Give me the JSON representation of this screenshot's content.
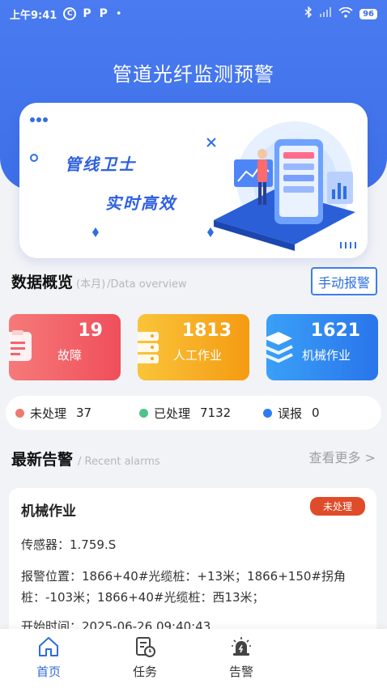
{
  "status_bar": {
    "time": "上午9:41",
    "battery": "96"
  },
  "header": {
    "title": "管道光纤监测预警"
  },
  "banner": {
    "line1": "管线卫士",
    "line2": "实时高效"
  },
  "overview": {
    "title": "数据概览",
    "period": "(本月)",
    "subtitle": "/Data overview",
    "manual_button": "手动报警",
    "cards": [
      {
        "value": "19",
        "label": "故障",
        "color": "#f0505c",
        "icon": "clipboard-icon"
      },
      {
        "value": "1813",
        "label": "人工作业",
        "color": "#f5a51a",
        "icon": "server-stack-icon"
      },
      {
        "value": "1621",
        "label": "机械作业",
        "color": "#2b7bed",
        "icon": "layers-icon"
      }
    ],
    "statuses": [
      {
        "label": "未处理",
        "value": "37",
        "color": "#ef7a6f"
      },
      {
        "label": "已处理",
        "value": "7132",
        "color": "#4cc38a"
      },
      {
        "label": "误报",
        "value": "0",
        "color": "#2e7cf0"
      }
    ]
  },
  "alarms": {
    "title": "最新告警",
    "subtitle": "/ Recent alarms",
    "more": "查看更多 >",
    "item": {
      "type": "机械作业",
      "status": "未处理",
      "sensor": "传感器：1.759.S",
      "location": "报警位置：1866+40#光缆桩：+13米；1866+150#拐角桩：-103米；1866+40#光缆桩：西13米；",
      "start_time": "开始时间：2025-06-26 09:40:43"
    }
  },
  "tabs": [
    {
      "label": "首页",
      "icon": "home-icon",
      "active": true
    },
    {
      "label": "任务",
      "icon": "task-clock-icon",
      "active": false
    },
    {
      "label": "告警",
      "icon": "alarm-light-icon",
      "active": false
    }
  ]
}
